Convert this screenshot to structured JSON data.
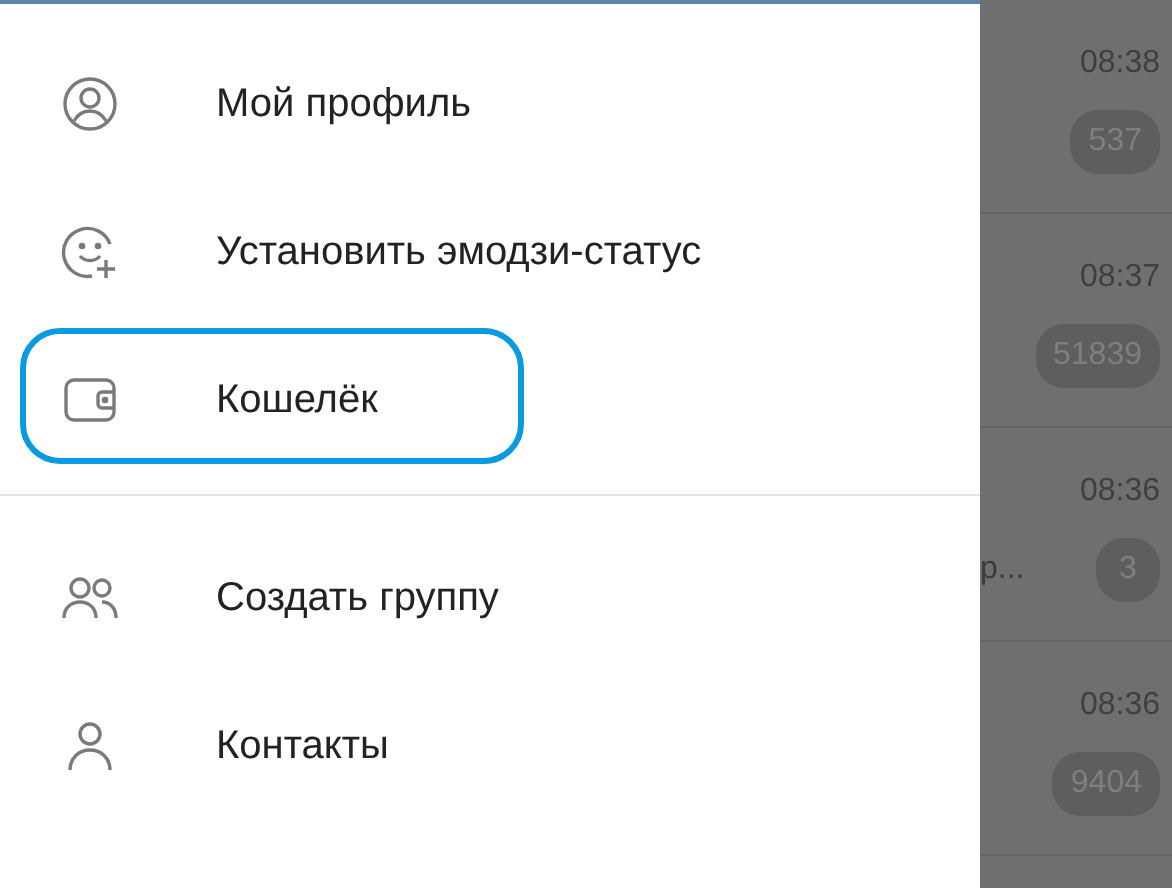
{
  "menu": {
    "items": [
      {
        "kind": "profile",
        "label": "Мой профиль",
        "highlighted": false
      },
      {
        "kind": "emoji",
        "label": "Установить эмодзи-статус",
        "highlighted": false
      },
      {
        "kind": "wallet",
        "label": "Кошелёк",
        "highlighted": true
      },
      {
        "kind": "divider"
      },
      {
        "kind": "group",
        "label": "Создать группу",
        "highlighted": false
      },
      {
        "kind": "contact",
        "label": "Контакты",
        "highlighted": false
      }
    ]
  },
  "chats": [
    {
      "time": "08:38",
      "unread": "537"
    },
    {
      "time": "08:37",
      "unread": "51839"
    },
    {
      "time": "08:36",
      "preview": "р...",
      "unread": "3"
    },
    {
      "time": "08:36",
      "unread": "9404"
    }
  ]
}
